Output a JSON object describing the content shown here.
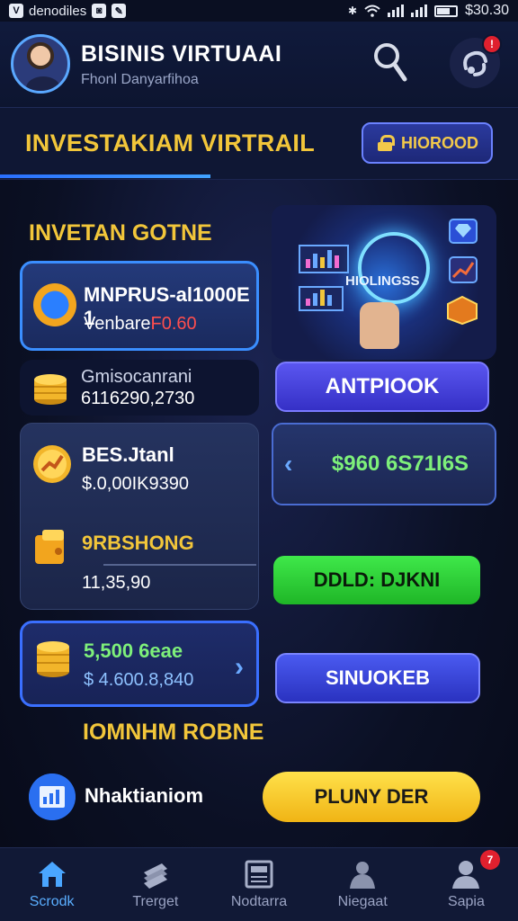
{
  "status": {
    "left_text": "denodiles",
    "time": "$30.30"
  },
  "header": {
    "title": "BISINIS VIRTUAAI",
    "subtitle": "Fhonl Danyarfihoa",
    "notification_count": ""
  },
  "section": {
    "title": "INVESTAKIAM VIRTRAIL",
    "button_label": "HIOROOD"
  },
  "left": {
    "heading": "INVETAN GOTNE",
    "card1": {
      "title": "MNPRUS-al1000E 1",
      "subtitle_prefix": "Venbare",
      "subtitle_value": "F0.60"
    },
    "card2": {
      "title": "Gmisocanrani",
      "value": "6116290,2730"
    },
    "card3": {
      "title_a": "BES.Jtanl",
      "value_a": "$.0,00IK9390",
      "title_b": "9RBSHONG",
      "value_b": "11,35,90"
    },
    "card4": {
      "title": "5,500 6eae",
      "value": "$ 4.600.8,840"
    }
  },
  "right": {
    "promo_label": "HIOLINGSS",
    "button1": "ANTPIOOK",
    "price": "$960 6S71I6S",
    "button2": "DDLD: DJKNI",
    "button3": "SINUOKEB"
  },
  "bottom_section": {
    "heading": "IOMNHM ROBNE",
    "report_label": "Nhaktianiom",
    "cta": "PLUNY DER"
  },
  "nav": {
    "items": [
      {
        "label": "Scrodk",
        "icon": "home-icon"
      },
      {
        "label": "Trerget",
        "icon": "stack-icon"
      },
      {
        "label": "Nodtarra",
        "icon": "news-icon"
      },
      {
        "label": "Niegaat",
        "icon": "person-icon"
      },
      {
        "label": "Sapia",
        "icon": "profile-icon"
      }
    ],
    "badge": "7"
  },
  "colors": {
    "gold": "#f2c63a",
    "accent": "#3a8eff",
    "green": "#1fb627",
    "yellow": "#f0b415",
    "danger": "#e0202e"
  }
}
